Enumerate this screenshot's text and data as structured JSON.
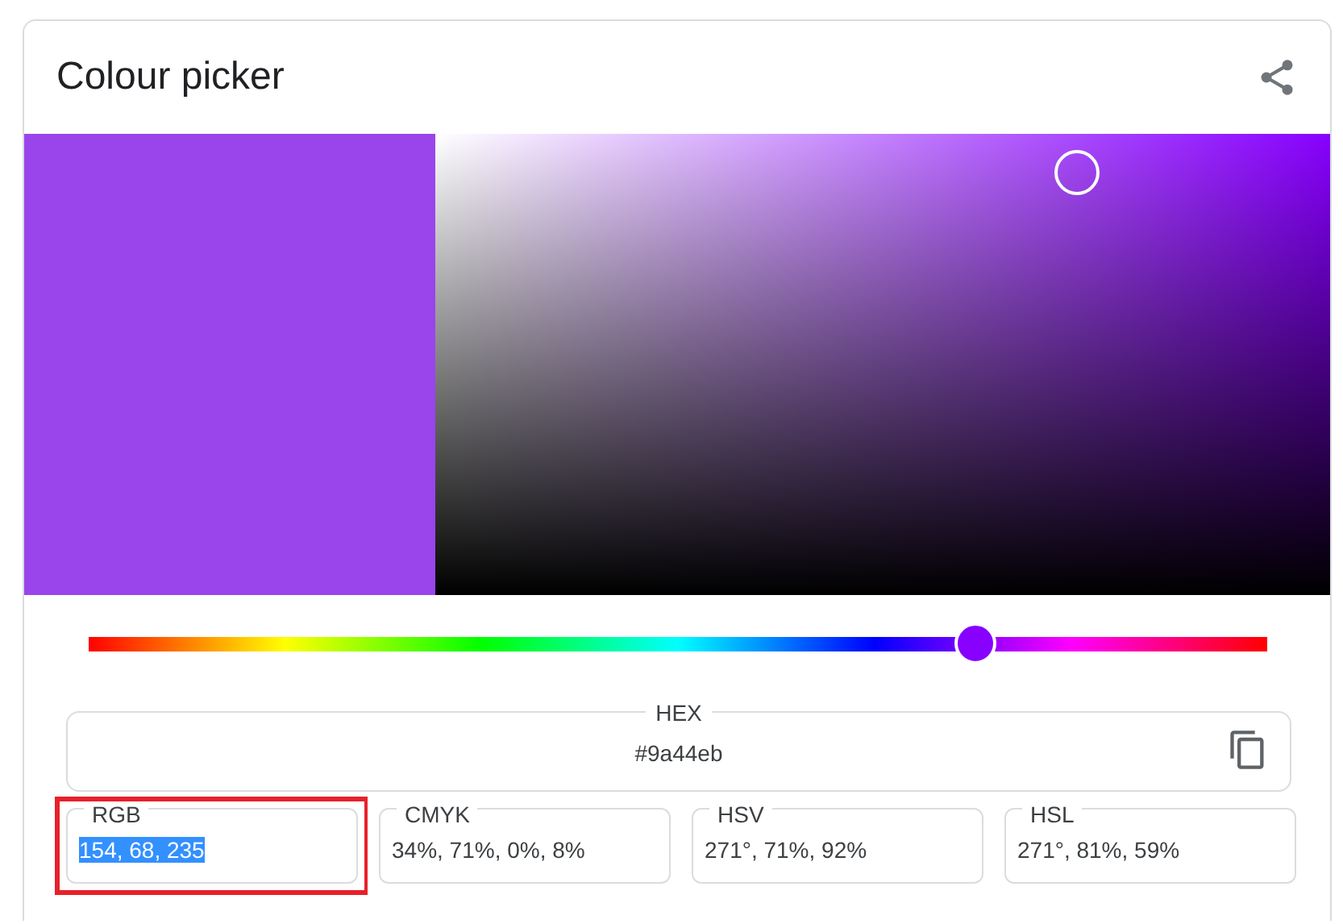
{
  "title": "Colour picker",
  "swatch": {
    "color": "#9a44eb"
  },
  "picker": {
    "color": "#8800ff"
  },
  "hue_slider": {
    "level": 0.753
  },
  "hex": {
    "label": "HEX",
    "value": "#9a44eb"
  },
  "fields": [
    {
      "label": "RGB",
      "value": "154, 68, 235",
      "selected": true,
      "highlighted": true
    },
    {
      "label": "CMYK",
      "value": "34%, 71%, 0%, 8%",
      "selected": false,
      "highlighted": false
    },
    {
      "label": "HSV",
      "value": "271°, 71%, 92%",
      "selected": false,
      "highlighted": false
    },
    {
      "label": "HSL",
      "value": "271°, 81%, 59%",
      "selected": false,
      "highlighted": false
    }
  ]
}
